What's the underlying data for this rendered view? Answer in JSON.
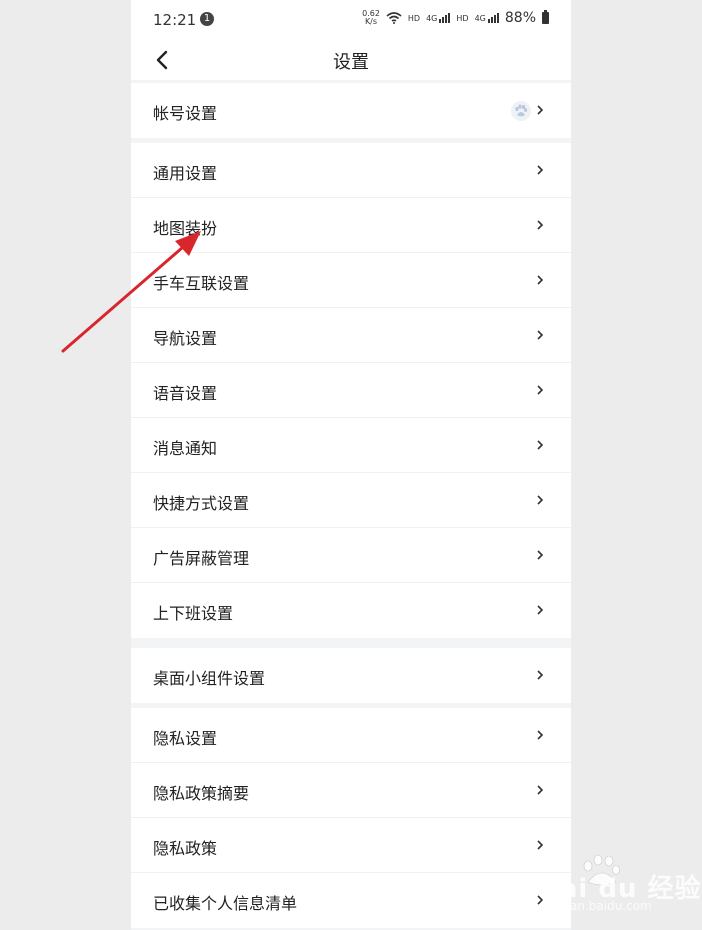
{
  "status_bar": {
    "time": "12:21",
    "notification_count": "1",
    "speed_value": "0.62",
    "speed_unit": "K/s",
    "hd1": "HD",
    "net1": "4G",
    "hd2": "HD",
    "net2": "4G",
    "battery": "88%"
  },
  "header": {
    "title": "设置"
  },
  "groups": [
    {
      "items": [
        {
          "label": "帐号设置"
        }
      ]
    },
    {
      "items": [
        {
          "label": "通用设置"
        },
        {
          "label": "地图装扮"
        },
        {
          "label": "手车互联设置"
        },
        {
          "label": "导航设置"
        },
        {
          "label": "语音设置"
        },
        {
          "label": "消息通知"
        },
        {
          "label": "快捷方式设置"
        },
        {
          "label": "广告屏蔽管理"
        },
        {
          "label": "上下班设置"
        }
      ]
    },
    {
      "items": [
        {
          "label": "桌面小组件设置"
        }
      ]
    },
    {
      "items": [
        {
          "label": "隐私设置"
        },
        {
          "label": "隐私政策摘要"
        },
        {
          "label": "隐私政策"
        },
        {
          "label": "已收集个人信息清单"
        }
      ]
    }
  ],
  "watermark": {
    "text": "Bai du 经验",
    "sub": "jingyan.baidu.com"
  },
  "colors": {
    "annotation_arrow": "#d9262c",
    "background": "#f3f4f6",
    "card": "#ffffff"
  }
}
